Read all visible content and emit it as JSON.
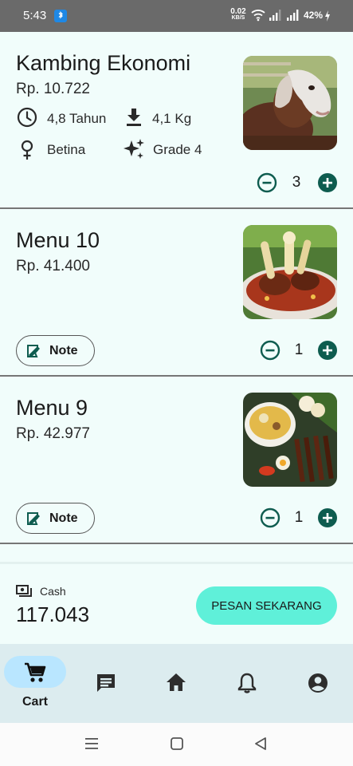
{
  "status_bar": {
    "time": "5:43",
    "net_speed": "0.02",
    "net_unit": "KB/S",
    "battery": "42%"
  },
  "items": [
    {
      "title": "Kambing Ekonomi",
      "price": "Rp. 10.722",
      "age": "4,8 Tahun",
      "weight": "4,1 Kg",
      "gender": "Betina",
      "grade": "Grade 4",
      "quantity": "3",
      "image": "goat-photo"
    },
    {
      "title": "Menu 10",
      "price": "Rp. 41.400",
      "note_label": "Note",
      "quantity": "1",
      "image": "meat-curry-photo"
    },
    {
      "title": "Menu 9",
      "price": "Rp. 42.977",
      "note_label": "Note",
      "quantity": "1",
      "image": "soup-satay-photo"
    }
  ],
  "checkout": {
    "cash_label": "Cash",
    "total": "117.043",
    "order_button": "PESAN SEKARANG"
  },
  "bottom_nav": {
    "active_label": "Cart",
    "items": [
      "cart-icon",
      "chat-icon",
      "home-icon",
      "bell-icon",
      "account-icon"
    ]
  },
  "colors": {
    "background": "#f1fdfb",
    "accent_green": "#0e5c4f",
    "order_button": "#5ff0d9",
    "nav_background": "#dcecef",
    "nav_active_pill": "#b9e6ff"
  }
}
